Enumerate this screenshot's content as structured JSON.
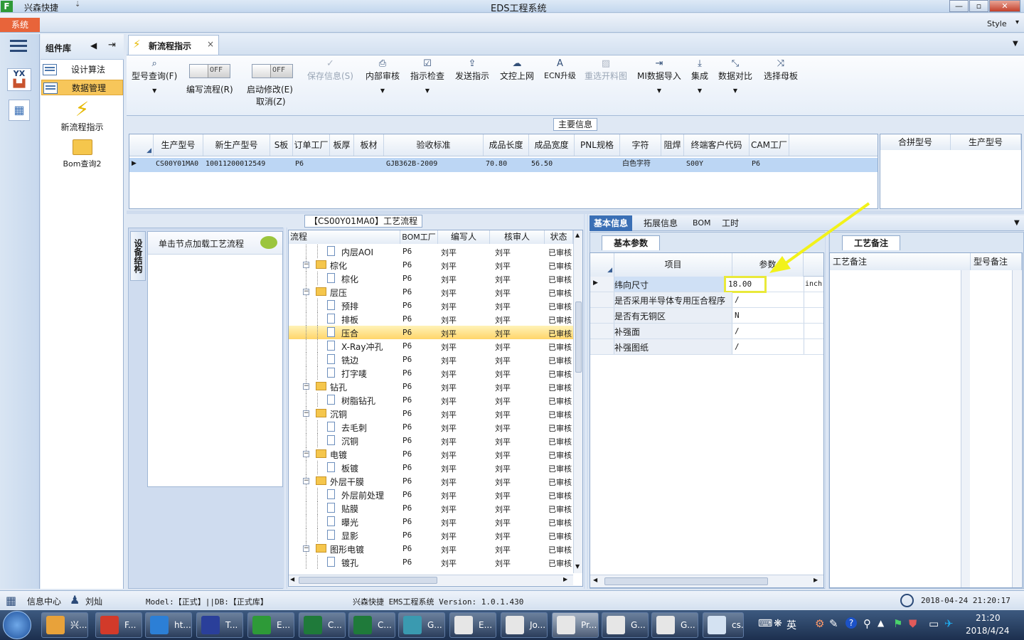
{
  "window": {
    "app_name": "兴森快捷",
    "title": "EDS工程系统",
    "min": "—",
    "max": "▫",
    "close": "✕"
  },
  "menu": {
    "system_tab": "系统",
    "style": "Style"
  },
  "sidebar": {
    "title": "组件库",
    "items": [
      {
        "label": "设计算法"
      },
      {
        "label": "数据管理"
      }
    ],
    "tools": [
      {
        "label": "新流程指示"
      },
      {
        "label": "Bom查询2"
      }
    ]
  },
  "doc_tab": {
    "label": "新流程指示",
    "close": "×"
  },
  "toolbar": {
    "model_query": "型号查询(F)",
    "edit_flow": "编写流程(R)",
    "edit_flow_toggle": "OFF",
    "start_modify": "启动修改(E)",
    "start_modify_toggle": "OFF",
    "cancel": "取消(Z)",
    "save": "保存信息(S)",
    "internal_review": "内部审核",
    "check_instruction": "指示检查",
    "send_instruction": "发送指示",
    "doc_upload": "文控上网",
    "ecn_upgrade": "ECN升级",
    "reselect_material": "重选开料图",
    "mi_import": "MI数据导入",
    "integrate": "集成",
    "data_compare": "数据对比",
    "select_master": "选择母板"
  },
  "main_info": {
    "caption": "主要信息",
    "columns": [
      "生产型号",
      "新生产型号",
      "S板",
      "订单工厂",
      "板厚",
      "板材",
      "验收标准",
      "成品长度",
      "成品宽度",
      "PNL规格",
      "字符",
      "阻焊",
      "终端客户代码",
      "CAM工厂"
    ],
    "rows": [
      [
        "CS00Y01MA0",
        "10011200012549",
        "",
        "P6",
        "",
        "",
        "GJB362B-2009",
        "70.80",
        "56.50",
        "",
        "白色字符",
        "",
        "S00Y",
        "P6"
      ]
    ],
    "side_columns": [
      "合拼型号",
      "生产型号"
    ]
  },
  "flow": {
    "caption": "【CS00Y01MA0】工艺流程",
    "side_tab": "设备结构",
    "hint": "单击节点加载工艺流程",
    "columns": [
      "流程",
      "BOM工厂",
      "编写人",
      "核审人",
      "状态"
    ],
    "rows": [
      {
        "name": "内层AOI",
        "level": 2,
        "type": "page",
        "bom": "P6",
        "writer": "刘平",
        "reviewer": "刘平",
        "status": "已审核"
      },
      {
        "name": "棕化",
        "level": 1,
        "type": "folder",
        "bom": "P6",
        "writer": "刘平",
        "reviewer": "刘平",
        "status": "已审核"
      },
      {
        "name": "棕化",
        "level": 2,
        "type": "page",
        "bom": "P6",
        "writer": "刘平",
        "reviewer": "刘平",
        "status": "已审核"
      },
      {
        "name": "层压",
        "level": 1,
        "type": "folder",
        "bom": "P6",
        "writer": "刘平",
        "reviewer": "刘平",
        "status": "已审核"
      },
      {
        "name": "预排",
        "level": 2,
        "type": "page",
        "bom": "P6",
        "writer": "刘平",
        "reviewer": "刘平",
        "status": "已审核"
      },
      {
        "name": "排板",
        "level": 2,
        "type": "page",
        "bom": "P6",
        "writer": "刘平",
        "reviewer": "刘平",
        "status": "已审核"
      },
      {
        "name": "压合",
        "level": 2,
        "type": "page",
        "bom": "P6",
        "writer": "刘平",
        "reviewer": "刘平",
        "status": "已审核",
        "selected": true
      },
      {
        "name": "X-Ray冲孔",
        "level": 2,
        "type": "page",
        "bom": "P6",
        "writer": "刘平",
        "reviewer": "刘平",
        "status": "已审核"
      },
      {
        "name": "铣边",
        "level": 2,
        "type": "page",
        "bom": "P6",
        "writer": "刘平",
        "reviewer": "刘平",
        "status": "已审核"
      },
      {
        "name": "打字唛",
        "level": 2,
        "type": "page",
        "bom": "P6",
        "writer": "刘平",
        "reviewer": "刘平",
        "status": "已审核"
      },
      {
        "name": "钻孔",
        "level": 1,
        "type": "folder",
        "bom": "P6",
        "writer": "刘平",
        "reviewer": "刘平",
        "status": "已审核"
      },
      {
        "name": "树脂钻孔",
        "level": 2,
        "type": "page",
        "bom": "P6",
        "writer": "刘平",
        "reviewer": "刘平",
        "status": "已审核"
      },
      {
        "name": "沉铜",
        "level": 1,
        "type": "folder",
        "bom": "P6",
        "writer": "刘平",
        "reviewer": "刘平",
        "status": "已审核"
      },
      {
        "name": "去毛刺",
        "level": 2,
        "type": "page",
        "bom": "P6",
        "writer": "刘平",
        "reviewer": "刘平",
        "status": "已审核"
      },
      {
        "name": "沉铜",
        "level": 2,
        "type": "page",
        "bom": "P6",
        "writer": "刘平",
        "reviewer": "刘平",
        "status": "已审核"
      },
      {
        "name": "电镀",
        "level": 1,
        "type": "folder",
        "bom": "P6",
        "writer": "刘平",
        "reviewer": "刘平",
        "status": "已审核"
      },
      {
        "name": "板镀",
        "level": 2,
        "type": "page",
        "bom": "P6",
        "writer": "刘平",
        "reviewer": "刘平",
        "status": "已审核"
      },
      {
        "name": "外层干膜",
        "level": 1,
        "type": "folder",
        "bom": "P6",
        "writer": "刘平",
        "reviewer": "刘平",
        "status": "已审核"
      },
      {
        "name": "外层前处理",
        "level": 2,
        "type": "page",
        "bom": "P6",
        "writer": "刘平",
        "reviewer": "刘平",
        "status": "已审核"
      },
      {
        "name": "贴膜",
        "level": 2,
        "type": "page",
        "bom": "P6",
        "writer": "刘平",
        "reviewer": "刘平",
        "status": "已审核"
      },
      {
        "name": "曝光",
        "level": 2,
        "type": "page",
        "bom": "P6",
        "writer": "刘平",
        "reviewer": "刘平",
        "status": "已审核"
      },
      {
        "name": "显影",
        "level": 2,
        "type": "page",
        "bom": "P6",
        "writer": "刘平",
        "reviewer": "刘平",
        "status": "已审核"
      },
      {
        "name": "图形电镀",
        "level": 1,
        "type": "folder",
        "bom": "P6",
        "writer": "刘平",
        "reviewer": "刘平",
        "status": "已审核"
      },
      {
        "name": "镀孔",
        "level": 2,
        "type": "page",
        "bom": "P6",
        "writer": "刘平",
        "reviewer": "刘平",
        "status": "已审核"
      }
    ]
  },
  "details": {
    "tabs": [
      "基本信息",
      "拓展信息",
      "BOM",
      "工时"
    ],
    "sub_tab": "基本参数",
    "columns": [
      "项目",
      "参数"
    ],
    "params": [
      {
        "key": "纬向尺寸",
        "value": "18.00",
        "unit": "inch"
      },
      {
        "key": "是否采用半导体专用压合程序",
        "value": "/",
        "unit": ""
      },
      {
        "key": "是否有无铜区",
        "value": "N",
        "unit": ""
      },
      {
        "key": "补强面",
        "value": "/",
        "unit": ""
      },
      {
        "key": "补强图纸",
        "value": "/",
        "unit": ""
      }
    ]
  },
  "notes": {
    "tab": "工艺备注",
    "columns": [
      "工艺备注",
      "型号备注"
    ]
  },
  "status": {
    "info_center": "信息中心",
    "user": "刘灿",
    "model": "Model:【正式】||DB:【正式库】",
    "system": "兴森快捷 EMS工程系统 Version: 1.0.1.430",
    "datetime": "2018-04-24 21:20:17"
  },
  "taskbar": {
    "items": [
      {
        "label": "兴...",
        "color": "#e8a23a"
      },
      {
        "label": "F...",
        "color": "#d23a2a"
      },
      {
        "label": "ht...",
        "color": "#2c7fd6"
      },
      {
        "label": "T...",
        "color": "#2a3f9a"
      },
      {
        "label": "E...",
        "color": "#2e9a38"
      },
      {
        "label": "C...",
        "color": "#1f7a3a"
      },
      {
        "label": "C...",
        "color": "#1f7a3a"
      },
      {
        "label": "G...",
        "color": "#3a9ab0"
      },
      {
        "label": "E...",
        "color": "#e6e6e6"
      },
      {
        "label": "Jo...",
        "color": "#e6e6e6"
      },
      {
        "label": "Pr...",
        "color": "#e6e6e6"
      },
      {
        "label": "G...",
        "color": "#e6e6e6"
      },
      {
        "label": "G...",
        "color": "#e6e6e6"
      },
      {
        "label": "cs...",
        "color": "#d4e2f2"
      }
    ],
    "ime": "英",
    "time": "21:20",
    "date": "2018/4/24"
  },
  "colors": {
    "accent": "#3a6fb5",
    "system_tab": "#e8643a",
    "selection": "#ffd56a",
    "annotation_arrow": "#f2f21a"
  }
}
